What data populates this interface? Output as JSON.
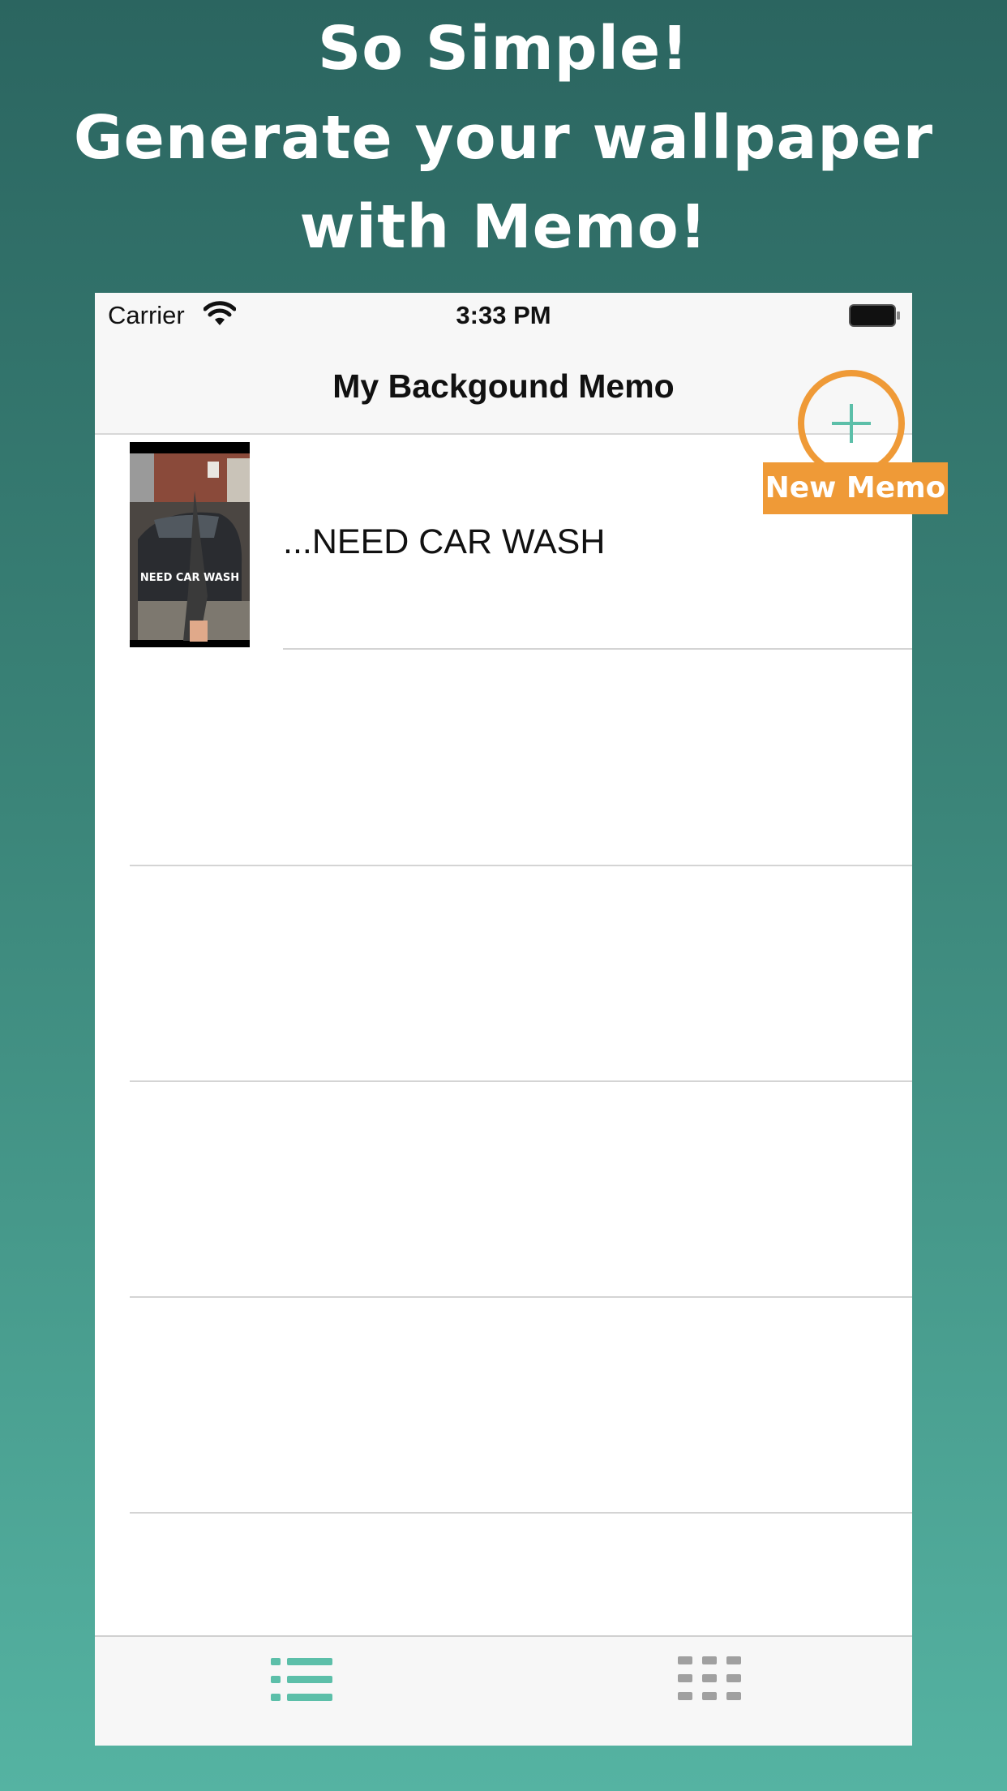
{
  "headline": {
    "line1": "So Simple!",
    "line2": "Generate your wallpaper",
    "line3": "with Memo!"
  },
  "status_bar": {
    "carrier": "Carrier",
    "time": "3:33 PM"
  },
  "nav": {
    "title": "My Backgound Memo",
    "add_icon": "plus-icon"
  },
  "callout": {
    "label": "New Memo",
    "color": "#ef9a37"
  },
  "memos": [
    {
      "text": "...NEED CAR WASH",
      "thumbnail_caption": "NEED CAR WASH"
    }
  ],
  "tabs": [
    {
      "icon": "list-icon",
      "active": true,
      "color": "#5cbfa9"
    },
    {
      "icon": "grid-icon",
      "active": false,
      "color": "#a0a0a0"
    }
  ],
  "colors": {
    "accent": "#5cbfa9",
    "highlight": "#ef9a37"
  }
}
